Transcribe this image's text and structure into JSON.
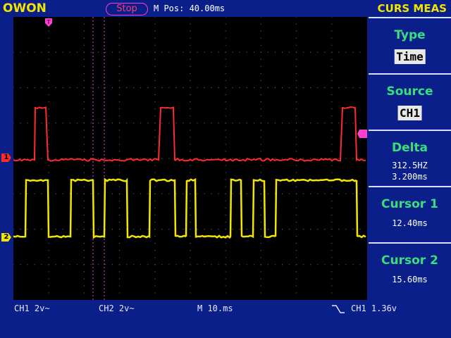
{
  "header": {
    "brand": "OWON",
    "status": "Stop",
    "mpos": "M Pos: 40.00ms",
    "mode": "CURS MEAS"
  },
  "panel": {
    "type_label": "Type",
    "type_value": "Time",
    "source_label": "Source",
    "source_value": "CH1",
    "delta_label": "Delta",
    "delta_freq": "312.5HZ",
    "delta_time": "3.200ms",
    "cursor1_label": "Cursor 1",
    "cursor1_value": "12.40ms",
    "cursor2_label": "Cursor 2",
    "cursor2_value": "15.60ms"
  },
  "footer": {
    "ch1": "CH1 2v~",
    "ch2": "CH2 2v~",
    "timebase": "M 10.ms",
    "trigger": "CH1 1.36v"
  },
  "markers": {
    "ch1": "1",
    "ch2": "2",
    "trigger_top": "T"
  },
  "colors": {
    "ch1": "#ff2a2a",
    "ch2": "#f2e600",
    "cursor": "#ff3fd0",
    "grid": "#7a7a7a"
  }
}
